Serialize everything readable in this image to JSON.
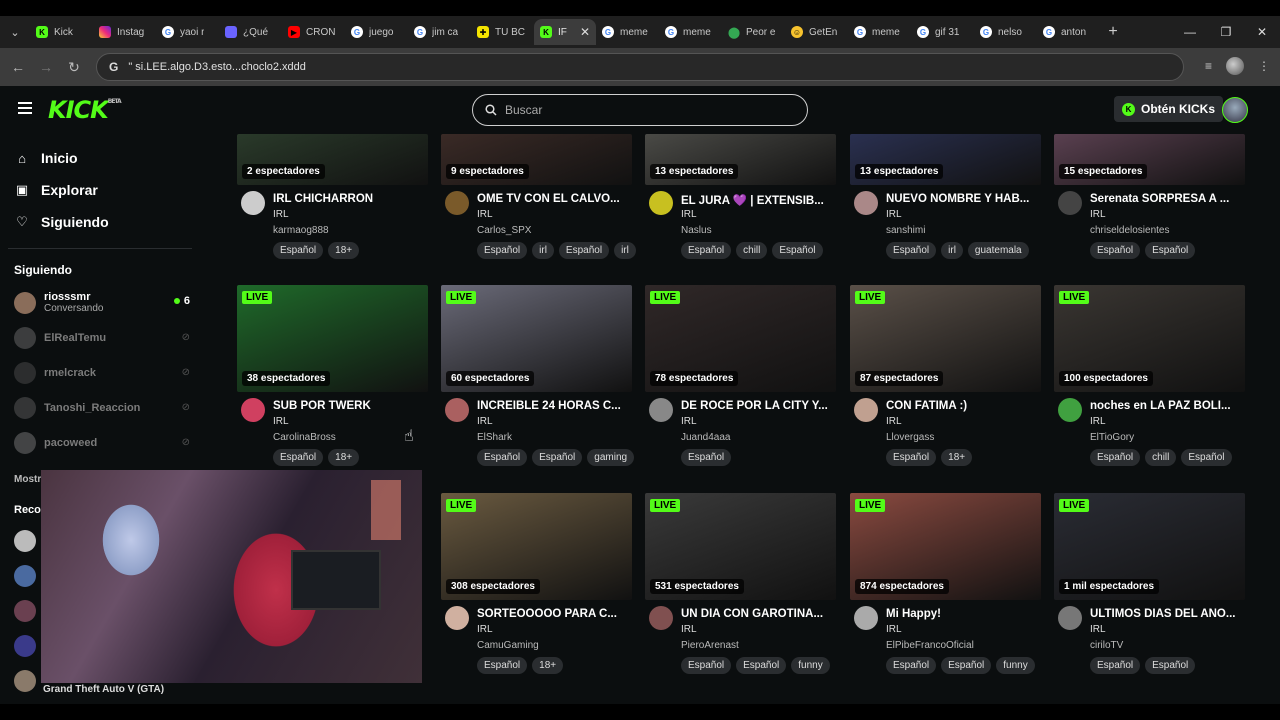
{
  "browser": {
    "tabs": [
      {
        "title": "Kick",
        "icon": "kick-icon"
      },
      {
        "title": "Instag",
        "icon": "instagram-icon"
      },
      {
        "title": "yaoi r",
        "icon": "google-icon"
      },
      {
        "title": "¿Qué",
        "icon": "messenger-icon"
      },
      {
        "title": "CRON",
        "icon": "youtube-icon"
      },
      {
        "title": "juego",
        "icon": "google-icon"
      },
      {
        "title": "jim ca",
        "icon": "google-icon"
      },
      {
        "title": "TU BC",
        "icon": "tu-icon"
      },
      {
        "title": "IF",
        "icon": "kick-icon",
        "active": true
      },
      {
        "title": "meme",
        "icon": "google-icon"
      },
      {
        "title": "meme",
        "icon": "google-icon"
      },
      {
        "title": "Peor e",
        "icon": "maps-icon"
      },
      {
        "title": "GetEn",
        "icon": "emoji-icon"
      },
      {
        "title": "meme",
        "icon": "google-icon"
      },
      {
        "title": "gif 31",
        "icon": "google-icon"
      },
      {
        "title": "nelso",
        "icon": "google-icon"
      },
      {
        "title": "anton",
        "icon": "google-icon"
      }
    ],
    "address": "\" si.LEE.algo.D3.esto...choclo2.xddd"
  },
  "kick": {
    "logo": "KICK",
    "logo_badge": "BETA",
    "search_placeholder": "Buscar",
    "kicks_button": "Obtén KICKs"
  },
  "sidebar": {
    "nav": [
      {
        "label": "Inicio",
        "icon": "home-icon"
      },
      {
        "label": "Explorar",
        "icon": "explore-icon"
      },
      {
        "label": "Siguiendo",
        "icon": "heart-icon"
      }
    ],
    "following_header": "Siguiendo",
    "following": [
      {
        "name": "riosssmr",
        "status": "Conversando",
        "viewers": "6",
        "live": true,
        "color": "#8a6d5a"
      },
      {
        "name": "ElRealTemu",
        "live": false,
        "color": "#777777"
      },
      {
        "name": "rmelcrack",
        "live": false,
        "color": "#555555"
      },
      {
        "name": "Tanoshi_Reaccion",
        "live": false,
        "color": "#666666"
      },
      {
        "name": "pacoweed",
        "live": false,
        "color": "#888888"
      }
    ],
    "more_label": "Mostr",
    "recommended_label": "Reco"
  },
  "grid_top": [
    {
      "viewers": "2 espectadores",
      "title": "IRL CHICHARRON",
      "category": "IRL",
      "channel": "karmaog888",
      "tags": [
        "Español",
        "18+"
      ],
      "thumb": "#2a3a2a",
      "avatar": "#cccccc"
    },
    {
      "viewers": "9 espectadores",
      "title": "OME TV CON EL CALVO...",
      "category": "IRL",
      "channel": "Carlos_SPX",
      "tags": [
        "Español",
        "irl",
        "Español",
        "irl"
      ],
      "thumb": "#3a2a26",
      "avatar": "#7a5a2a"
    },
    {
      "viewers": "13 espectadores",
      "title": "EL JURA 💜 | EXTENSIB...",
      "category": "IRL",
      "channel": "Naslus",
      "tags": [
        "Español",
        "chill",
        "Español"
      ],
      "thumb": "#4a4a46",
      "avatar": "#c8c020"
    },
    {
      "viewers": "13 espectadores",
      "title": "NUEVO NOMBRE Y HAB...",
      "category": "IRL",
      "channel": "sanshimi",
      "tags": [
        "Español",
        "irl",
        "guatemala"
      ],
      "thumb": "#2a3050",
      "avatar": "#aa8888"
    },
    {
      "viewers": "15 espectadores",
      "title": "Serenata SORPRESA A ...",
      "category": "IRL",
      "channel": "chriseldelosientes",
      "tags": [
        "Español",
        "Español"
      ],
      "thumb": "#5a4050",
      "avatar": "#444444"
    }
  ],
  "grid_mid": [
    {
      "viewers": "38 espectadores",
      "title": "SUB POR TWERK",
      "category": "IRL",
      "channel": "CarolinaBross",
      "tags": [
        "Español",
        "18+"
      ],
      "thumb": "#1f6a2a",
      "avatar": "#d04060"
    },
    {
      "viewers": "60 espectadores",
      "title": "INCREIBLE 24 HORAS C...",
      "category": "IRL",
      "channel": "ElShark",
      "tags": [
        "Español",
        "Español",
        "gaming"
      ],
      "thumb": "#6a6a78",
      "avatar": "#aa6060"
    },
    {
      "viewers": "78 espectadores",
      "title": "DE ROCE POR LA CITY Y...",
      "category": "IRL",
      "channel": "Juand4aaa",
      "tags": [
        "Español"
      ],
      "thumb": "#302828",
      "avatar": "#888888"
    },
    {
      "viewers": "87 espectadores",
      "title": "CON FATIMA :)",
      "category": "IRL",
      "channel": "Llovergass",
      "tags": [
        "Español",
        "18+"
      ],
      "thumb": "#5a5048",
      "avatar": "#c0a090"
    },
    {
      "viewers": "100 espectadores",
      "title": "noches en LA PAZ BOLI...",
      "category": "IRL",
      "channel": "ElTioGory",
      "tags": [
        "Español",
        "chill",
        "Español"
      ],
      "thumb": "#3a3632",
      "avatar": "#40a040"
    }
  ],
  "grid_bottom": [
    {
      "viewers": "308 espectadores",
      "title": "SORTEOOOOO PARA C...",
      "category": "IRL",
      "channel": "CamuGaming",
      "tags": [
        "Español",
        "18+"
      ],
      "thumb": "#6a5a40",
      "avatar": "#d0b0a0"
    },
    {
      "viewers": "531 espectadores",
      "title": "UN DÍA CON GAROTIÑA...",
      "category": "IRL",
      "channel": "PieroArenast",
      "tags": [
        "Español",
        "Español",
        "funny"
      ],
      "thumb": "#3a3a3a",
      "avatar": "#805050"
    },
    {
      "viewers": "874 espectadores",
      "title": "Mi Happy!",
      "category": "IRL",
      "channel": "ElPibeFrancoOficial",
      "tags": [
        "Español",
        "Español",
        "funny"
      ],
      "thumb": "#8a4a40",
      "avatar": "#aaaaaa"
    },
    {
      "viewers": "1 mil espectadores",
      "title": "ULTIMOS DIAS DEL AÑO...",
      "category": "IRL",
      "channel": "ciriloTV",
      "tags": [
        "Español",
        "Español"
      ],
      "thumb": "#2a2c34",
      "avatar": "#777777"
    }
  ],
  "live_badge": "LIVE",
  "overlay": {
    "game_label": "Grand Theft Auto V (GTA)"
  },
  "colors": {
    "kick_green": "#53fc18",
    "bg": "#0b0e0f",
    "tag_bg": "#2a2d30"
  }
}
